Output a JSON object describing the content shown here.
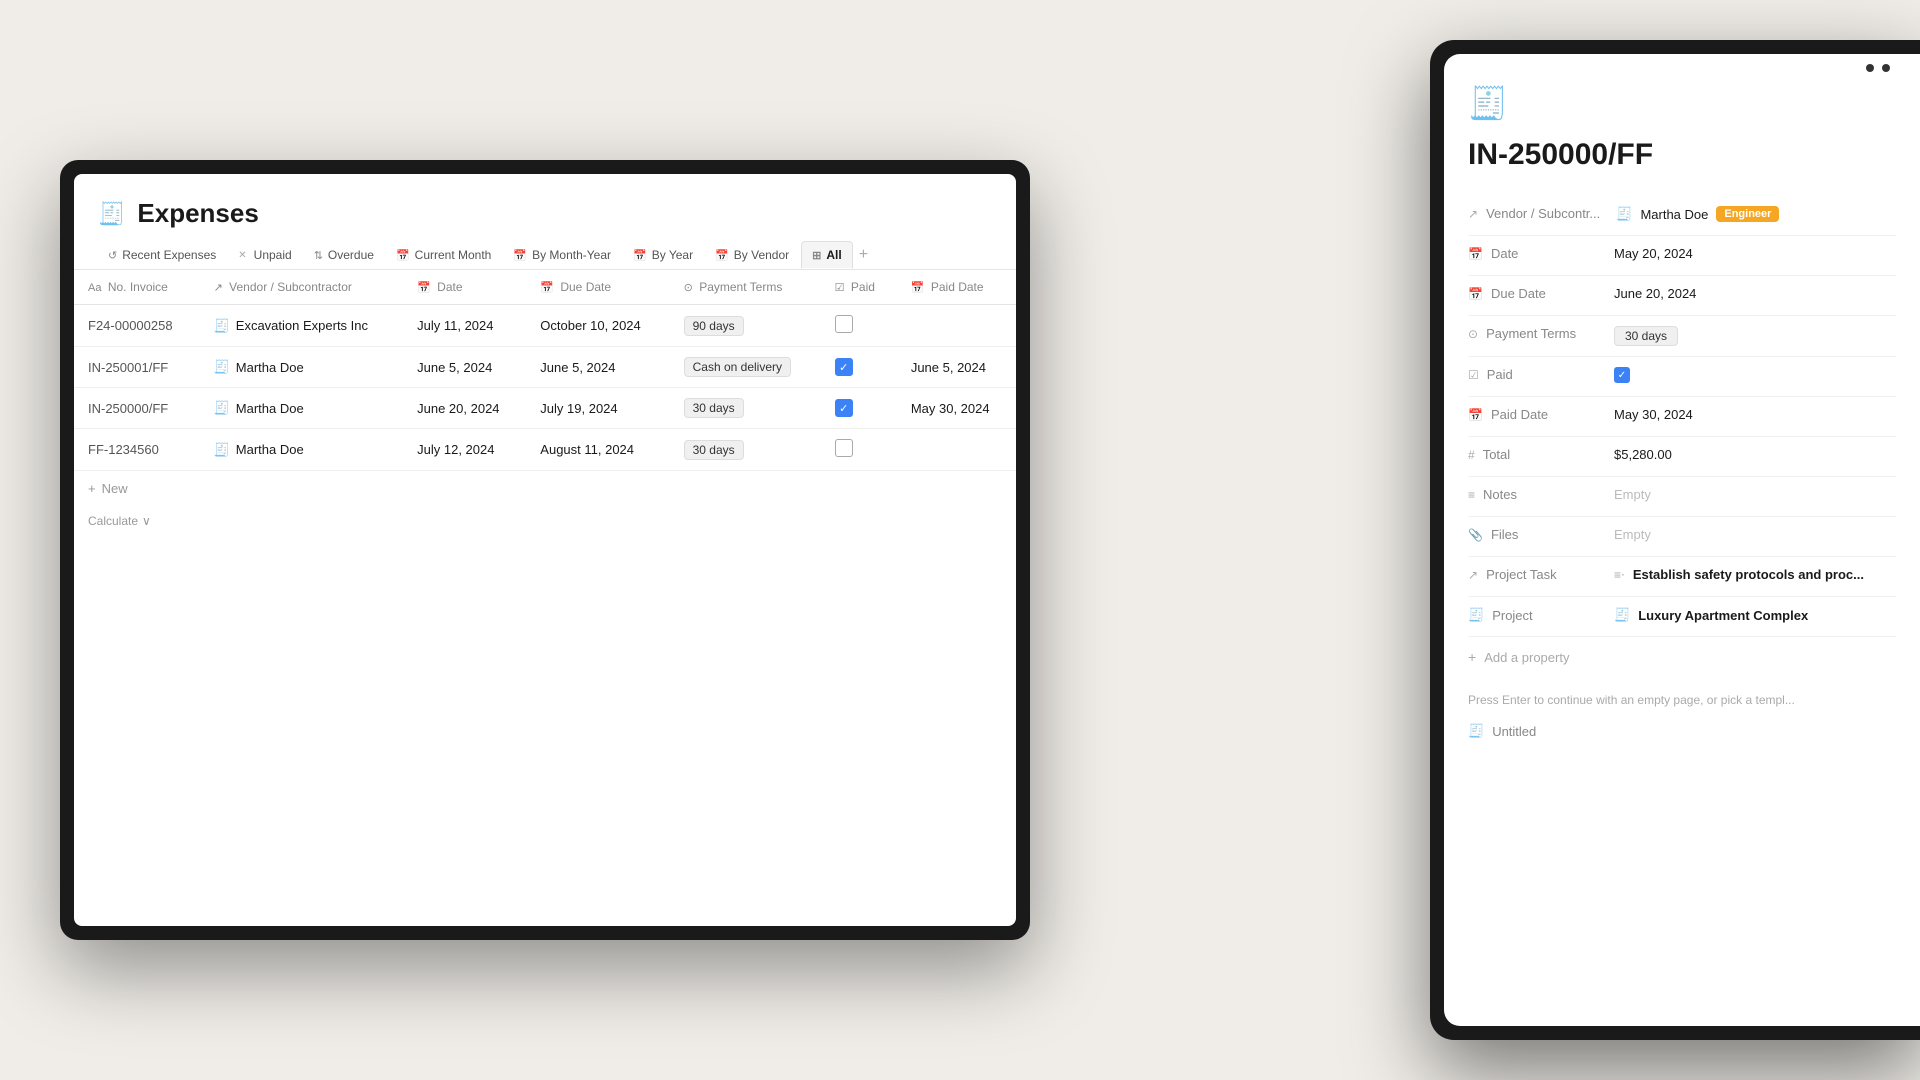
{
  "background": "#f0ede8",
  "laptop": {
    "expenses": {
      "title": "Expenses",
      "icon": "🧾",
      "tabs": [
        {
          "id": "recent",
          "label": "Recent Expenses",
          "icon": "↺",
          "active": false,
          "closeable": false
        },
        {
          "id": "unpaid",
          "label": "Unpaid",
          "icon": "✕",
          "active": false,
          "closeable": true
        },
        {
          "id": "overdue",
          "label": "Overdue",
          "icon": "⇅",
          "active": false,
          "closeable": false
        },
        {
          "id": "current-month",
          "label": "Current Month",
          "icon": "📅",
          "active": false,
          "closeable": false
        },
        {
          "id": "by-month-year",
          "label": "By Month-Year",
          "icon": "📅",
          "active": false,
          "closeable": false
        },
        {
          "id": "by-year",
          "label": "By Year",
          "icon": "📅",
          "active": false,
          "closeable": false
        },
        {
          "id": "by-vendor",
          "label": "By Vendor",
          "icon": "📅",
          "active": false,
          "closeable": false
        },
        {
          "id": "all",
          "label": "All",
          "icon": "⊞",
          "active": true,
          "closeable": false
        }
      ],
      "table": {
        "columns": [
          {
            "id": "invoice",
            "label": "No. Invoice",
            "icon": "Aa"
          },
          {
            "id": "vendor",
            "label": "Vendor / Subcontractor",
            "icon": "↗"
          },
          {
            "id": "date",
            "label": "Date",
            "icon": "📅"
          },
          {
            "id": "due-date",
            "label": "Due Date",
            "icon": "📅"
          },
          {
            "id": "payment-terms",
            "label": "Payment Terms",
            "icon": "⊙"
          },
          {
            "id": "paid",
            "label": "Paid",
            "icon": "☑"
          },
          {
            "id": "paid-date",
            "label": "Paid Date",
            "icon": "📅"
          }
        ],
        "rows": [
          {
            "invoice": "F24-00000258",
            "vendor": "Excavation Experts Inc",
            "date": "July 11, 2024",
            "due_date": "October 10, 2024",
            "payment_terms": "90 days",
            "paid": false,
            "paid_date": ""
          },
          {
            "invoice": "IN-250001/FF",
            "vendor": "Martha Doe",
            "date": "June 5, 2024",
            "due_date": "June 5, 2024",
            "payment_terms": "Cash on delivery",
            "paid": true,
            "paid_date": "June 5, 2024"
          },
          {
            "invoice": "IN-250000/FF",
            "vendor": "Martha Doe",
            "date": "June 20, 2024",
            "due_date": "July 19, 2024",
            "payment_terms": "30 days",
            "paid": true,
            "paid_date": "May 30, 2024"
          },
          {
            "invoice": "FF-1234560",
            "vendor": "Martha Doe",
            "date": "July 12, 2024",
            "due_date": "August 11, 2024",
            "payment_terms": "30 days",
            "paid": false,
            "paid_date": ""
          }
        ],
        "new_label": "New",
        "calculate_label": "Calculate"
      }
    }
  },
  "tablet": {
    "detail": {
      "icon": "🧾",
      "title": "IN-250000/FF",
      "fields": [
        {
          "id": "vendor",
          "label": "Vendor / Subcontr...",
          "icon": "↗",
          "value": "Martha Doe",
          "badge": "Engineer"
        },
        {
          "id": "date",
          "label": "Date",
          "icon": "📅",
          "value": "May 20, 2024"
        },
        {
          "id": "due-date",
          "label": "Due Date",
          "icon": "📅",
          "value": "June 20, 2024"
        },
        {
          "id": "payment-terms",
          "label": "Payment Terms",
          "icon": "⊙",
          "value": "30 days",
          "type": "badge"
        },
        {
          "id": "paid",
          "label": "Paid",
          "icon": "☑",
          "value": true,
          "type": "checkbox"
        },
        {
          "id": "paid-date",
          "label": "Paid Date",
          "icon": "📅",
          "value": "May 30, 2024"
        },
        {
          "id": "total",
          "label": "Total",
          "icon": "#",
          "value": "$5,280.00"
        },
        {
          "id": "notes",
          "label": "Notes",
          "icon": "≡",
          "value": "Empty",
          "empty": true
        },
        {
          "id": "files",
          "label": "Files",
          "icon": "📎",
          "value": "Empty",
          "empty": true
        },
        {
          "id": "project-task",
          "label": "Project Task",
          "icon": "↗",
          "value": "Establish safety protocols and proc..."
        },
        {
          "id": "project",
          "label": "Project",
          "icon": "🧾",
          "value": "Luxury Apartment Complex"
        }
      ],
      "add_property_label": "Add a property",
      "press_enter_hint": "Press Enter to continue with an empty page, or pick a templ...",
      "untitled_label": "Untitled"
    }
  }
}
